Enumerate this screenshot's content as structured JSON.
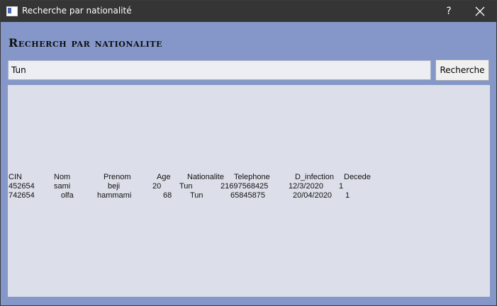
{
  "window": {
    "title": "Recherche par nationalité",
    "help_label": "?"
  },
  "heading": "Recherch par nationalite",
  "search": {
    "value": "Tun",
    "button_label": "Recherche"
  },
  "results": {
    "headers": [
      "CIN",
      "Nom",
      "Prenom",
      "Age",
      "Nationalite",
      "Telephone",
      "D_infection",
      "Decede"
    ],
    "rows": [
      [
        "452654",
        "sami",
        "beji",
        "20",
        "Tun",
        "21697568425",
        "12/3/2020",
        "1"
      ],
      [
        "742654",
        "olfa",
        "hammami",
        "68",
        "Tun",
        "65845875",
        "20/04/2020",
        "1"
      ]
    ]
  }
}
